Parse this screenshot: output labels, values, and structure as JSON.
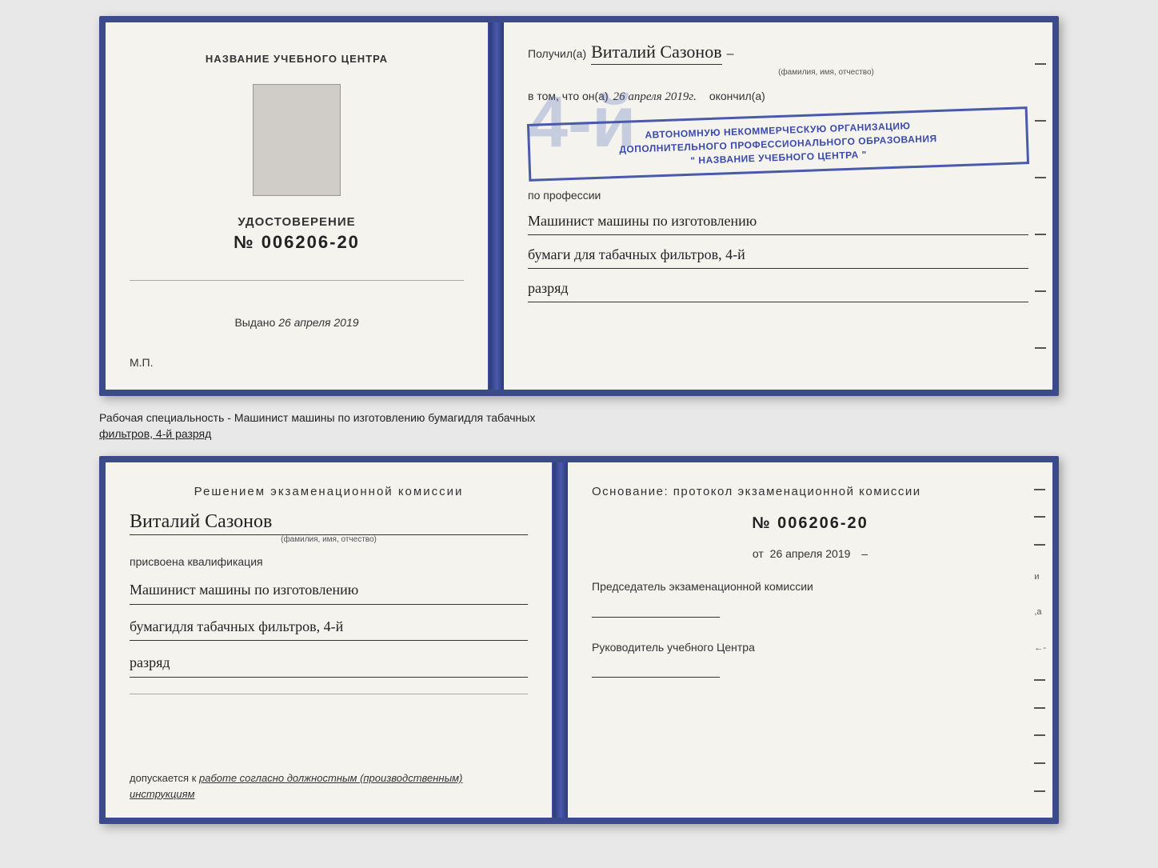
{
  "topCert": {
    "leftPage": {
      "trainingCenterLabel": "НАЗВАНИЕ УЧЕБНОГО ЦЕНТРА",
      "udostoverenie": "УДОСТОВЕРЕНИЕ",
      "number": "№ 006206-20",
      "vydanoLabel": "Выдано",
      "vydanoDate": "26 апреля 2019",
      "mpLabel": "М.П."
    },
    "rightPage": {
      "poluchilLabel": "Получил(а)",
      "recipientName": "Виталий Сазонов",
      "recipientHint": "(фамилия, имя, отчество)",
      "dashAfterName": "–",
      "vtomChtoLabel": "в том, что он(а)",
      "dateValue": "26 апреля 2019г.",
      "okonchilLabel": "окончил(а)",
      "stampLine1": "АВТОНОМНУЮ НЕКОММЕРЧЕСКУЮ ОРГАНИЗАЦИЮ",
      "stampLine2": "ДОПОЛНИТЕЛЬНОГО ПРОФЕССИОНАЛЬНОГО ОБРАЗОВАНИЯ",
      "stampLine3": "\" НАЗВАНИЕ УЧЕБНОГО ЦЕНТРА \"",
      "bigNumber": "4-й",
      "poProfessiiLabel": "по профессии",
      "professionLine1": "Машинист машины по изготовлению",
      "professionLine2": "бумаги для табачных фильтров, 4-й",
      "professionLine3": "разряд"
    }
  },
  "middleText": {
    "text1": "Рабочая специальность - Машинист машины по изготовлению бумагидля табачных",
    "text2": "фильтров, 4-й разряд"
  },
  "bottomCert": {
    "leftPage": {
      "resheniyemTitle": "Решением  экзаменационной  комиссии",
      "name": "Виталий Сазонов",
      "nameHint": "(фамилия, имя, отчество)",
      "prisvoenaLabel": "присвоена квалификация",
      "qualLine1": "Машинист машины по изготовлению",
      "qualLine2": "бумагидля табачных фильтров, 4-й",
      "qualLine3": "разряд",
      "dopuskaetsyaLabel": "допускается к",
      "dopuskText": "работе согласно должностным (производственным) инструкциям"
    },
    "rightPage": {
      "osnovanieTitlePart1": "Основание: протокол экзаменационной  комиссии",
      "protocolNumber": "№  006206-20",
      "otLabel": "от",
      "otDate": "26 апреля 2019",
      "predsedatelTitle": "Председатель экзаменационной комиссии",
      "rukovoditelTitle": "Руководитель учебного Центра"
    }
  }
}
